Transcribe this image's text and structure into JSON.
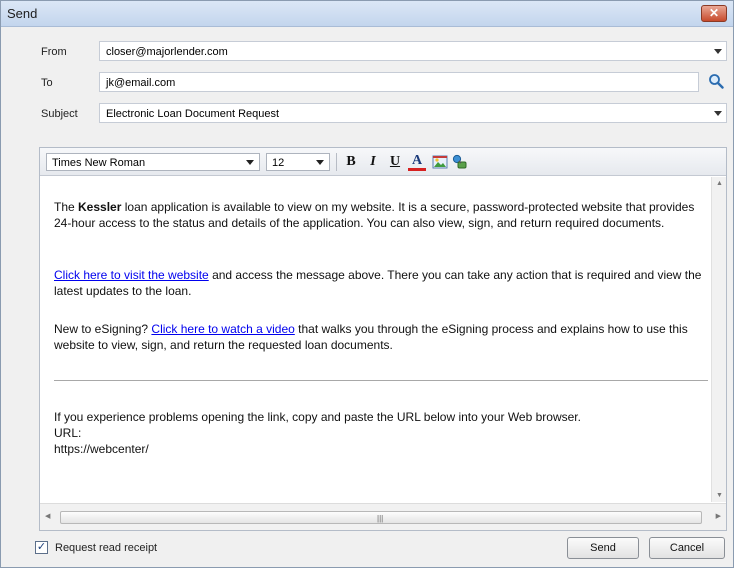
{
  "window": {
    "title": "Send",
    "close_glyph": "✕"
  },
  "form": {
    "from_label": "From",
    "from_value": "closer@majorlender.com",
    "to_label": "To",
    "to_value": "jk@email.com",
    "subject_label": "Subject",
    "subject_value": "Electronic Loan Document Request"
  },
  "toolbar": {
    "font_family": "Times New Roman",
    "font_size": "12",
    "bold": "B",
    "italic": "I",
    "underline": "U",
    "font_color": "A",
    "icons": [
      "bold-icon",
      "italic-icon",
      "underline-icon",
      "font-color-icon",
      "insert-image-icon",
      "insert-link-icon"
    ]
  },
  "message": {
    "p1_pre": "The ",
    "p1_name": "Kessler",
    "p1_post": " loan application is available to view on my website. It is a secure, password-protected website that provides 24-hour access to the status and details of the application. You can also view, sign, and return required documents.",
    "p2_link": "Click here to visit the website",
    "p2_post": " and access the message above. There you can take any action that is required and view the latest updates to the loan.",
    "p3_pre": "New to eSigning? ",
    "p3_link": "Click here to watch a video",
    "p3_post": " that walks you through the eSigning process and explains how to use this website to view, sign, and return the requested loan documents.",
    "p4": "If you experience problems opening the link, copy and paste the URL below into your Web browser.",
    "url_label": "URL:",
    "url_value": "https://webcenter/"
  },
  "footer": {
    "read_receipt_label": "Request read receipt",
    "read_receipt_checked": true,
    "check_glyph": "✓",
    "send_label": "Send",
    "cancel_label": "Cancel"
  },
  "colors": {
    "link": "#0000ee",
    "title_bar": "#c3d5ed",
    "close_button": "#c74a2c"
  }
}
